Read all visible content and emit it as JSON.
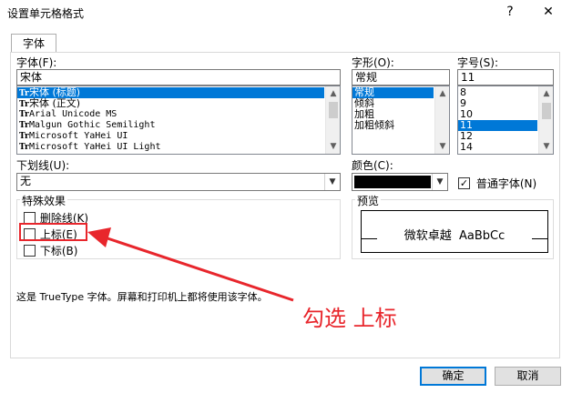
{
  "window": {
    "title": "设置单元格格式",
    "help_button": "?",
    "close_button": "✕"
  },
  "tabs": [
    {
      "label": "字体"
    }
  ],
  "font": {
    "label": "字体(F):",
    "value": "宋体",
    "items": [
      {
        "text": "宋体 (标题)",
        "selected": true
      },
      {
        "text": "宋体 (正文)"
      },
      {
        "text": "Arial Unicode MS"
      },
      {
        "text": "Malgun Gothic Semilight"
      },
      {
        "text": "Microsoft YaHei UI"
      },
      {
        "text": "Microsoft YaHei UI Light"
      }
    ]
  },
  "style": {
    "label": "字形(O):",
    "value": "常规",
    "items": [
      {
        "text": "常规",
        "selected": true
      },
      {
        "text": "倾斜"
      },
      {
        "text": "加粗"
      },
      {
        "text": "加粗倾斜"
      }
    ]
  },
  "size": {
    "label": "字号(S):",
    "value": "11",
    "items": [
      {
        "text": "8"
      },
      {
        "text": "9"
      },
      {
        "text": "10"
      },
      {
        "text": "11",
        "selected": true
      },
      {
        "text": "12"
      },
      {
        "text": "14"
      }
    ]
  },
  "underline": {
    "label": "下划线(U):",
    "value": "无"
  },
  "color": {
    "label": "颜色(C):",
    "swatch": "#000000"
  },
  "normal_font": {
    "label": "普通字体(N)",
    "checked": true
  },
  "effects": {
    "title": "特殊效果",
    "strikethrough": "删除线(K)",
    "superscript": "上标(E)",
    "subscript": "下标(B)"
  },
  "preview": {
    "title": "预览",
    "sample": "微软卓越  AaBbCc"
  },
  "info_text": "这是 TrueType 字体。屏幕和打印机上都将使用该字体。",
  "annotation": {
    "text": "勾选 上标",
    "color": "#e8262c"
  },
  "buttons": {
    "ok": "确定",
    "cancel": "取消"
  },
  "icons": {
    "truetype": "Tr"
  }
}
